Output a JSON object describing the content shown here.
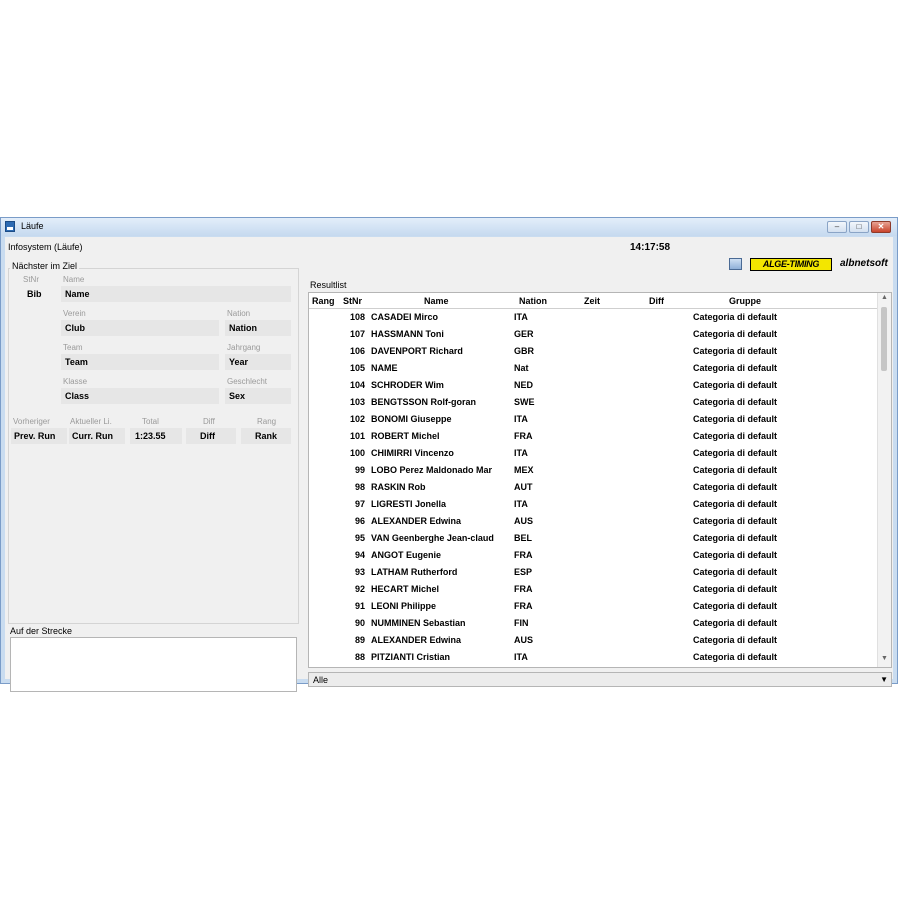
{
  "window": {
    "title": "Läufe",
    "minimize": "–",
    "maximize": "□",
    "close": "✕"
  },
  "header": {
    "title": "Infosystem (Läufe)",
    "clock": "14:17:58",
    "logo_alge": "ALGE-TIMING",
    "logo_alb": "albnetsoft"
  },
  "next_panel": {
    "title": "Nächster im Ziel",
    "labels": {
      "stnr": "StNr",
      "name": "Name",
      "verein": "Verein",
      "nation": "Nation",
      "team": "Team",
      "jahrgang": "Jahrgang",
      "klasse": "Klasse",
      "geschlecht": "Geschlecht",
      "vorheriger": "Vorheriger",
      "aktueller": "Aktueller Li.",
      "total": "Total",
      "diff": "Diff",
      "rang": "Rang"
    },
    "values": {
      "bib": "Bib",
      "name": "Name",
      "club": "Club",
      "nation": "Nation",
      "team": "Team",
      "year": "Year",
      "class": "Class",
      "sex": "Sex",
      "prev_run": "Prev. Run",
      "curr_run": "Curr. Run",
      "total": "1:23.55",
      "diff": "Diff",
      "rank": "Rank"
    }
  },
  "track_panel": {
    "title": "Auf der Strecke"
  },
  "results": {
    "title": "Resultlist",
    "columns": [
      "Rang",
      "StNr",
      "Name",
      "Nation",
      "Zeit",
      "Diff",
      "Gruppe"
    ],
    "rows": [
      {
        "stnr": "108",
        "name": "CASADEI Mirco",
        "nation": "ITA",
        "gruppe": "Categoria di default"
      },
      {
        "stnr": "107",
        "name": "HASSMANN Toni",
        "nation": "GER",
        "gruppe": "Categoria di default"
      },
      {
        "stnr": "106",
        "name": "DAVENPORT Richard",
        "nation": "GBR",
        "gruppe": "Categoria di default"
      },
      {
        "stnr": "105",
        "name": "NAME",
        "nation": "Nat",
        "gruppe": "Categoria di default"
      },
      {
        "stnr": "104",
        "name": "SCHRODER Wim",
        "nation": "NED",
        "gruppe": "Categoria di default"
      },
      {
        "stnr": "103",
        "name": "BENGTSSON Rolf-goran",
        "nation": "SWE",
        "gruppe": "Categoria di default"
      },
      {
        "stnr": "102",
        "name": "BONOMI Giuseppe",
        "nation": "ITA",
        "gruppe": "Categoria di default"
      },
      {
        "stnr": "101",
        "name": "ROBERT Michel",
        "nation": "FRA",
        "gruppe": "Categoria di default"
      },
      {
        "stnr": "100",
        "name": "CHIMIRRI Vincenzo",
        "nation": "ITA",
        "gruppe": "Categoria di default"
      },
      {
        "stnr": "99",
        "name": "LOBO Perez Maldonado Mar",
        "nation": "MEX",
        "gruppe": "Categoria di default"
      },
      {
        "stnr": "98",
        "name": "RASKIN Rob",
        "nation": "AUT",
        "gruppe": "Categoria di default"
      },
      {
        "stnr": "97",
        "name": "LIGRESTI Jonella",
        "nation": "ITA",
        "gruppe": "Categoria di default"
      },
      {
        "stnr": "96",
        "name": "ALEXANDER Edwina",
        "nation": "AUS",
        "gruppe": "Categoria di default"
      },
      {
        "stnr": "95",
        "name": "VAN Geenberghe Jean-claud",
        "nation": "BEL",
        "gruppe": "Categoria di default"
      },
      {
        "stnr": "94",
        "name": "ANGOT Eugenie",
        "nation": "FRA",
        "gruppe": "Categoria di default"
      },
      {
        "stnr": "93",
        "name": "LATHAM Rutherford",
        "nation": "ESP",
        "gruppe": "Categoria di default"
      },
      {
        "stnr": "92",
        "name": "HECART Michel",
        "nation": "FRA",
        "gruppe": "Categoria di default"
      },
      {
        "stnr": "91",
        "name": "LEONI Philippe",
        "nation": "FRA",
        "gruppe": "Categoria di default"
      },
      {
        "stnr": "90",
        "name": "NUMMINEN Sebastian",
        "nation": "FIN",
        "gruppe": "Categoria di default"
      },
      {
        "stnr": "89",
        "name": "ALEXANDER Edwina",
        "nation": "AUS",
        "gruppe": "Categoria di default"
      },
      {
        "stnr": "88",
        "name": "PITZIANTI Cristian",
        "nation": "ITA",
        "gruppe": "Categoria di default"
      }
    ]
  },
  "filter": {
    "selected": "Alle"
  },
  "icons": {
    "monitor": "monitor-icon",
    "dropdown": "chevron-down-icon",
    "scroll_up": "scroll-up-icon",
    "scroll_down": "scroll-down-icon"
  },
  "colors": {
    "alge_yellow": "#f3e600",
    "window_frame": "#c9dcf0",
    "close_button": "#c9442c"
  }
}
